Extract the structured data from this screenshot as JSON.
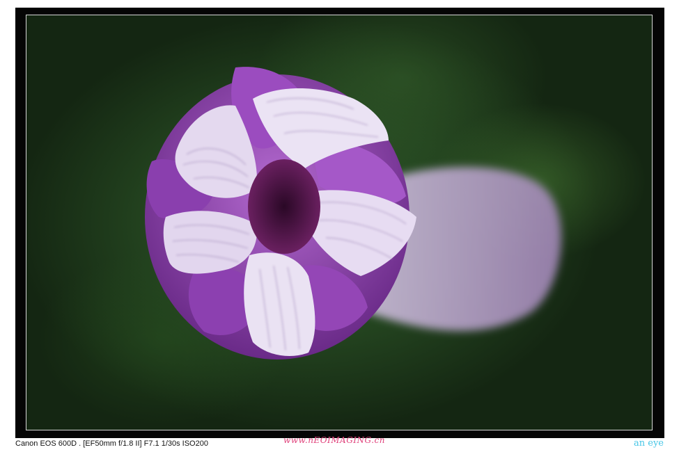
{
  "photo": {
    "subject": "morning-glory-bud",
    "colors": {
      "background": "#23431f",
      "petal_purple": "#8a3fa6",
      "petal_white": "#e6dcf0",
      "throat": "#4a1440"
    }
  },
  "captions": {
    "camera_info": "Canon EOS 600D . [EF50mm f/1.8 II] F7.1 1/30s ISO200",
    "site_watermark": "www.nEOIMAGING.cn",
    "signature": "an eye"
  }
}
